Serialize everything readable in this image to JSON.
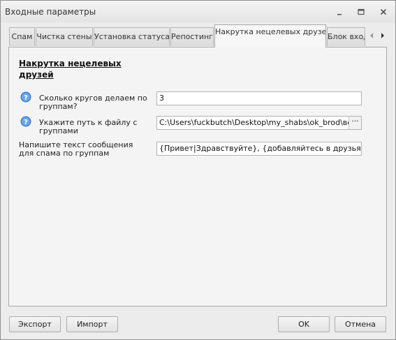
{
  "window": {
    "title": "Входные параметры"
  },
  "tabs": [
    {
      "label": "Спам",
      "active": false
    },
    {
      "label": "Чистка стены",
      "active": false
    },
    {
      "label": "Установка статуса",
      "active": false
    },
    {
      "label": "Репостинг",
      "active": false
    },
    {
      "label": "Накрутка нецелевых друзей",
      "active": true
    },
    {
      "label": "Блок вход",
      "active": false
    }
  ],
  "panel": {
    "title": "Накрутка нецелевых друзей",
    "fields": [
      {
        "label": "Сколько кругов делаем по группам?",
        "value": "3"
      },
      {
        "label": "Укажите путь к файлу с группами",
        "value": "C:\\Users\\fuckbutch\\Desktop\\my_shabs\\ok_brod\\версия",
        "browse_label": "···"
      },
      {
        "label": "Напишите текст сообщения для спама по группам",
        "value": "{Привет|Здравствуйте}, {добавляйтесь в друзья|добав"
      }
    ]
  },
  "buttons": {
    "export": "Экспорт",
    "import": "Импорт",
    "ok": "OK",
    "cancel": "Отмена"
  },
  "colors": {
    "help_icon": "#3b7fd0"
  }
}
